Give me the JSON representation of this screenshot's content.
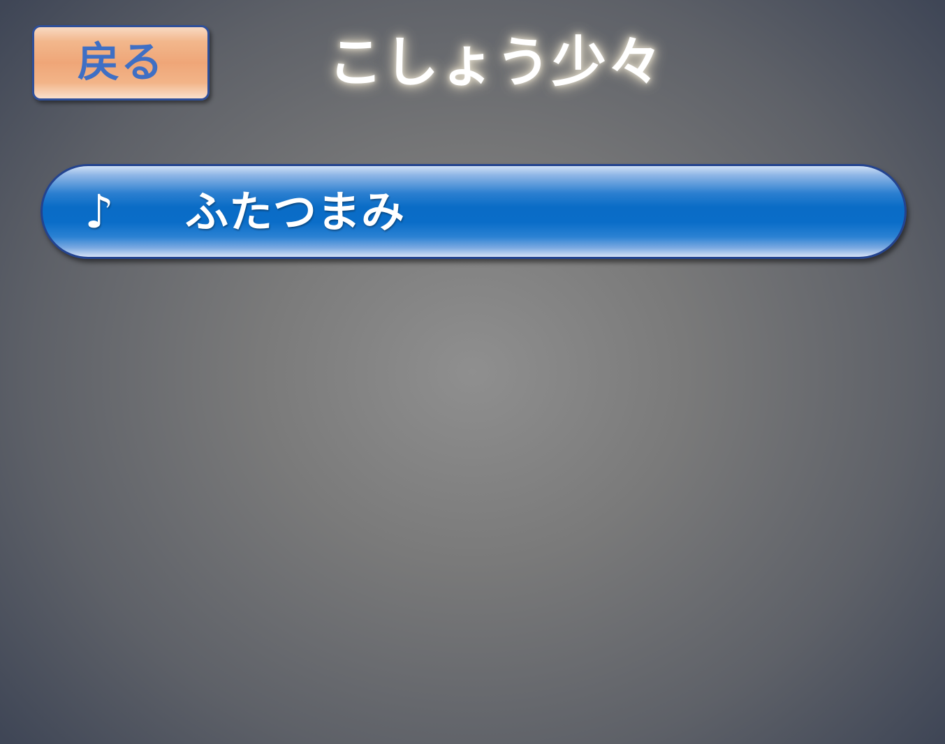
{
  "header": {
    "back_label": "戻る",
    "title": "こしょう少々"
  },
  "songs": [
    {
      "icon": "music-note-icon",
      "icon_glyph": "♪",
      "title": "ふたつまみ"
    }
  ],
  "colors": {
    "back_button": "#efa678",
    "back_label": "#3f6fc4",
    "song_item": "#0a6cc6",
    "border": "#23438f"
  }
}
